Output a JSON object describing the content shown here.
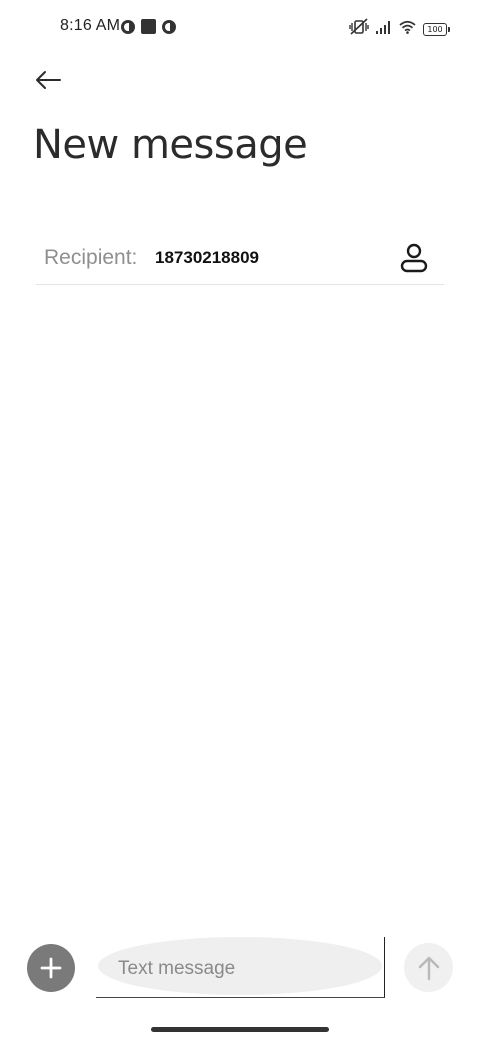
{
  "status_bar": {
    "time": "8:16 AM",
    "battery_level": "100",
    "icons": [
      "app-notification-icon",
      "square-notification-icon",
      "app-notification-icon",
      "vibrate-off-icon",
      "signal-icon",
      "wifi-icon",
      "battery-icon"
    ]
  },
  "header": {
    "back_icon": "arrow-left-icon",
    "title": "New message"
  },
  "recipient": {
    "label": "Recipient:",
    "value": "18730218809",
    "contact_icon": "person-icon"
  },
  "compose": {
    "add_icon": "plus-icon",
    "placeholder": "Text message",
    "value": "",
    "send_icon": "arrow-up-icon"
  },
  "colors": {
    "background": "#ffffff",
    "title": "#2b2b2b",
    "label": "#8f8f8f",
    "add_button": "#7a7a7a",
    "compose_bg": "#efefef",
    "send_button": "#f0f0f0"
  }
}
